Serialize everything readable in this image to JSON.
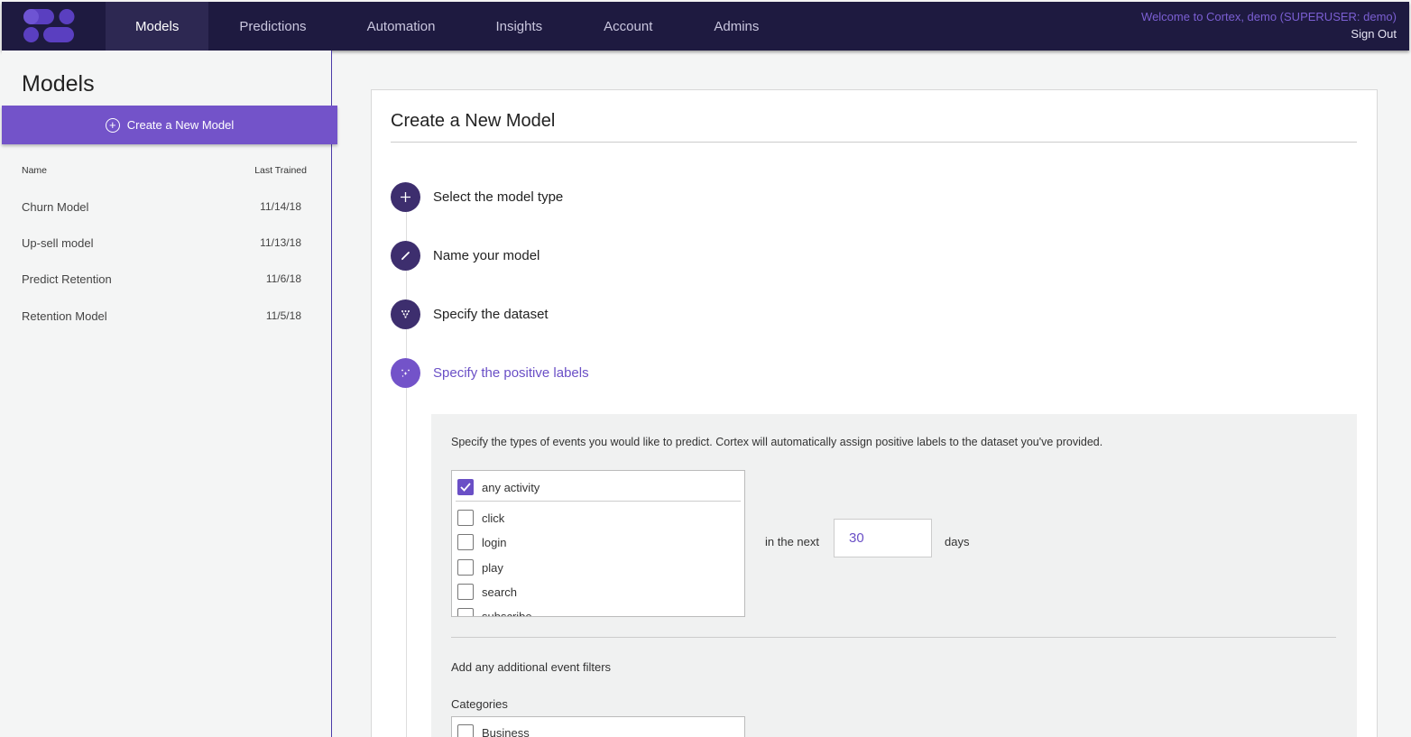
{
  "nav": {
    "items": [
      {
        "label": "Models",
        "active": true
      },
      {
        "label": "Predictions",
        "active": false
      },
      {
        "label": "Automation",
        "active": false
      },
      {
        "label": "Insights",
        "active": false
      },
      {
        "label": "Account",
        "active": false
      },
      {
        "label": "Admins",
        "active": false
      }
    ],
    "welcome": "Welcome to Cortex, demo (SUPERUSER: demo)",
    "sign_out": "Sign Out"
  },
  "sidebar": {
    "title": "Models",
    "create_button": "Create a New Model",
    "columns": {
      "name": "Name",
      "last_trained": "Last Trained"
    },
    "rows": [
      {
        "name": "Churn Model",
        "date": "11/14/18"
      },
      {
        "name": "Up-sell model",
        "date": "11/13/18"
      },
      {
        "name": "Predict Retention",
        "date": "11/6/18"
      },
      {
        "name": "Retention Model",
        "date": "11/5/18"
      }
    ]
  },
  "main": {
    "title": "Create a New Model",
    "steps": [
      {
        "label": "Select the model type",
        "icon": "plus-icon"
      },
      {
        "label": "Name your model",
        "icon": "pencil-icon"
      },
      {
        "label": "Specify the dataset",
        "icon": "dataset-icon"
      },
      {
        "label": "Specify the positive labels",
        "icon": "sparkle-icon",
        "active": true
      }
    ],
    "panel": {
      "instructions": "Specify the types of events you would like to predict. Cortex will automatically assign positive labels to the dataset you've provided.",
      "events": [
        {
          "label": "any activity",
          "checked": true
        },
        {
          "label": "click",
          "checked": false
        },
        {
          "label": "login",
          "checked": false
        },
        {
          "label": "play",
          "checked": false
        },
        {
          "label": "search",
          "checked": false
        },
        {
          "label": "subscribe",
          "checked": false
        }
      ],
      "in_the_next": "in the next",
      "days_value": "30",
      "days_label": "days",
      "filters_label": "Add any additional event filters",
      "categories_label": "Categories",
      "categories": [
        {
          "label": "Business",
          "checked": false
        }
      ]
    }
  },
  "colors": {
    "nav_bg": "#1e1a40",
    "accent": "#7353c9",
    "step_icon": "#3d2e6e"
  }
}
